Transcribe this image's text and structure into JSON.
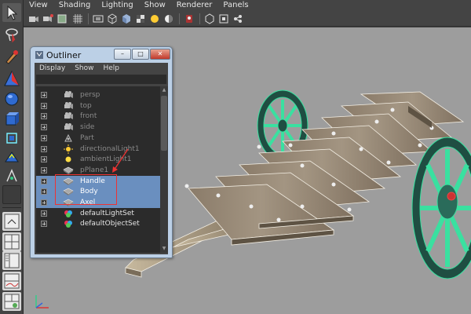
{
  "panel_menu": [
    "View",
    "Shading",
    "Lighting",
    "Show",
    "Renderer",
    "Panels"
  ],
  "icon_bar": {
    "icons": [
      "camera-icon",
      "bookmark-icon",
      "image-plane-icon",
      "grid-toggle-icon",
      "film-gate-icon",
      "wireframe-icon",
      "smooth-shade-icon",
      "textured-icon",
      "lights-icon",
      "shadows-icon",
      "xray-icon",
      "isolate-icon",
      "isolate-select-icon",
      "ssao-icon"
    ]
  },
  "toolbox": {
    "tools": [
      "select-tool-icon",
      "lasso-tool-icon",
      "paint-select-tool-icon",
      "move-tool-icon",
      "rotate-tool-icon",
      "scale-tool-icon",
      "universal-manipulator-icon",
      "soft-mod-icon",
      "show-manipulator-icon",
      "last-tool-icon",
      "single-pane-layout-icon",
      "four-pane-layout-icon",
      "outliner-persp-layout-icon",
      "graph-editor-layout-icon",
      "hypershade-layout-icon"
    ]
  },
  "outliner": {
    "title": "Outliner",
    "menus": [
      "Display",
      "Show",
      "Help"
    ],
    "window_buttons": {
      "minimize": "–",
      "maximize": "□",
      "close": "✕"
    },
    "rows": [
      {
        "label": "persp",
        "icon": "camera-icon",
        "style": "dim",
        "selected": false
      },
      {
        "label": "top",
        "icon": "camera-icon",
        "style": "dim",
        "selected": false
      },
      {
        "label": "front",
        "icon": "camera-icon",
        "style": "dim",
        "selected": false
      },
      {
        "label": "side",
        "icon": "camera-icon",
        "style": "dim",
        "selected": false
      },
      {
        "label": "Part",
        "icon": "transform-icon",
        "style": "dim",
        "selected": false
      },
      {
        "label": "directionalLight1",
        "icon": "directional-light-icon",
        "style": "dim",
        "selected": false
      },
      {
        "label": "ambientLight1",
        "icon": "ambient-light-icon",
        "style": "dim",
        "selected": false
      },
      {
        "label": "pPlane1",
        "icon": "mesh-icon",
        "style": "dim",
        "selected": false
      },
      {
        "label": "Handle",
        "icon": "mesh-icon",
        "style": "norm",
        "selected": true
      },
      {
        "label": "Body",
        "icon": "mesh-icon",
        "style": "norm",
        "selected": true
      },
      {
        "label": "Axel",
        "icon": "mesh-icon",
        "style": "norm",
        "selected": true
      },
      {
        "label": "defaultLightSet",
        "icon": "set-icon",
        "style": "norm",
        "selected": false
      },
      {
        "label": "defaultObjectSet",
        "icon": "set-icon",
        "style": "norm",
        "selected": false
      }
    ]
  },
  "colors": {
    "selection": "#6a8fbf",
    "annotation": "#e33333",
    "wireframe_highlight": "#40e0a0",
    "viewport_bg": "#9d9d9d"
  }
}
